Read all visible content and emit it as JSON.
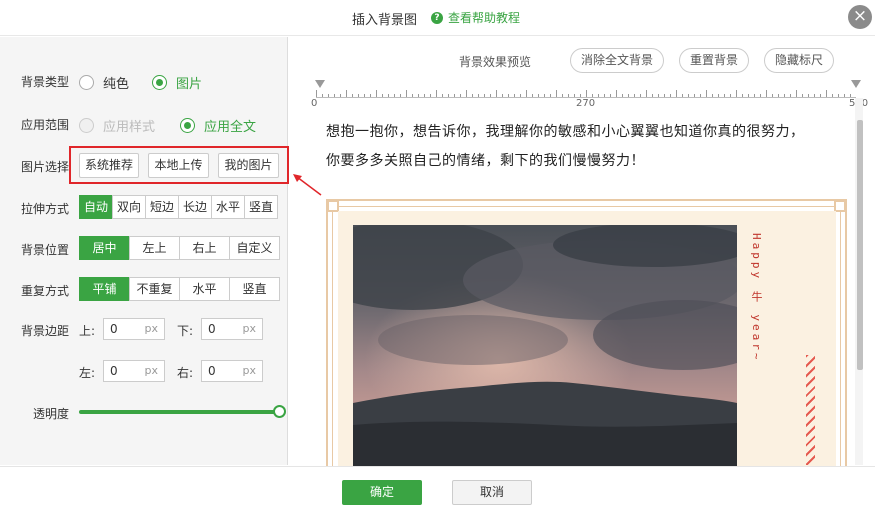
{
  "dialog": {
    "title": "插入背景图",
    "help_link": "查看帮助教程",
    "close_glyph": "×"
  },
  "left": {
    "bg_type": {
      "label": "背景类型",
      "options": [
        "纯色",
        "图片"
      ],
      "selected": "图片"
    },
    "apply_scope": {
      "label": "应用范围",
      "options": [
        "应用样式",
        "应用全文"
      ],
      "disabled": "应用样式",
      "selected": "应用全文"
    },
    "image_select": {
      "label": "图片选择",
      "buttons": [
        "系统推荐",
        "本地上传",
        "我的图片"
      ]
    },
    "stretch": {
      "label": "拉伸方式",
      "options": [
        "自动",
        "双向",
        "短边",
        "长边",
        "水平",
        "竖直"
      ],
      "selected": "自动"
    },
    "position": {
      "label": "背景位置",
      "options": [
        "居中",
        "左上",
        "右上",
        "自定义"
      ],
      "selected": "居中"
    },
    "repeat": {
      "label": "重复方式",
      "options": [
        "平铺",
        "不重复",
        "水平",
        "竖直"
      ],
      "selected": "平铺"
    },
    "margin": {
      "label": "背景边距",
      "top_label": "上:",
      "bottom_label": "下:",
      "left_label": "左:",
      "right_label": "右:",
      "top": "0",
      "bottom": "0",
      "left": "0",
      "right": "0",
      "unit": "px"
    },
    "opacity": {
      "label": "透明度",
      "value": 1.0
    }
  },
  "right": {
    "preview_label": "背景效果预览",
    "buttons": [
      "消除全文背景",
      "重置背景",
      "隐藏标尺"
    ],
    "ruler": {
      "start": "0",
      "mid": "270",
      "end": "540"
    },
    "doc_lines": [
      "想抱一抱你，想告诉你，我理解你的敏感和小心翼翼也知道你真的很努力，",
      "你要多多关照自己的情绪，剩下的我们慢慢努力！"
    ],
    "card_text": "Happy 牛 year~"
  },
  "footer": {
    "ok": "确定",
    "cancel": "取消"
  },
  "colors": {
    "accent": "#3aa443",
    "highlight_box": "#e0262a",
    "frame": "#e8c9a5",
    "card_bg": "#fbf1e1",
    "card_text": "#c0362c"
  }
}
